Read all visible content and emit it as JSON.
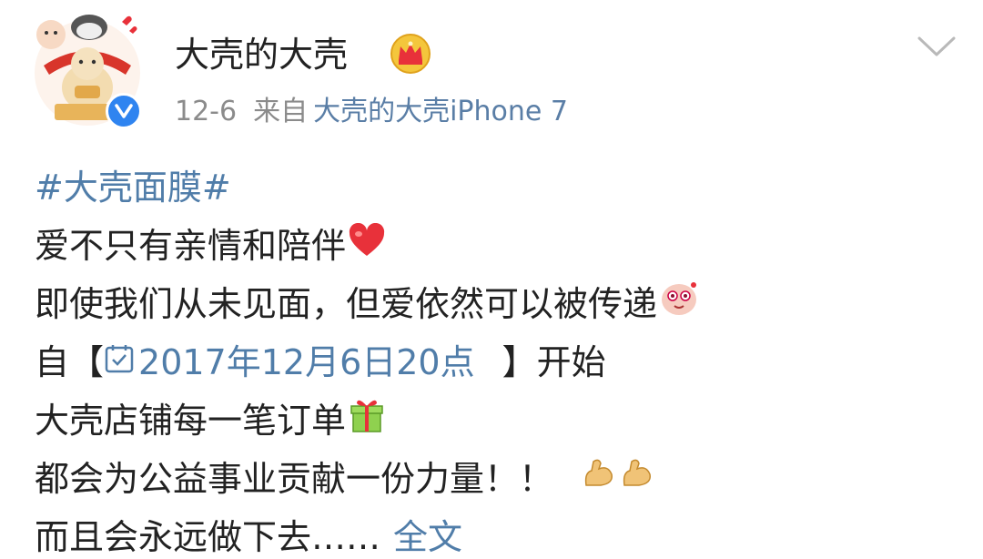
{
  "user": {
    "name": "大壳的大壳",
    "avatar_icon": "avatar-cartoon-couple",
    "verified_icon": "verified-badge-icon",
    "crown_icon": "crown-icon"
  },
  "meta": {
    "date": "12-6",
    "from_label": "来自",
    "source": "大壳的大壳iPhone 7"
  },
  "post": {
    "hashtag": "#大壳面膜#",
    "line1": "爱不只有亲情和陪伴",
    "line2": "即使我们从未见面，但爱依然可以被传递",
    "line3_prefix": "自【",
    "line3_date": "2017年12月6日20点",
    "line3_suffix": "】开始",
    "line4": "大壳店铺每一笔订单",
    "line5": "都会为公益事业贡献一份力量！！",
    "line6": "而且会永远做下去……",
    "full_text_link": "全文"
  },
  "colors": {
    "link": "#507da9",
    "meta": "#8b8b8b",
    "verified": "#2f84f0",
    "heart": "#e8313a"
  }
}
